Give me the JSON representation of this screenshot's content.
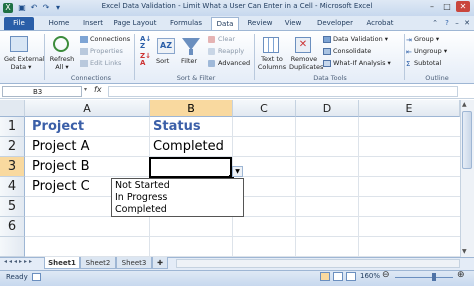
{
  "window": {
    "title": "Excel Data Validation - Limit What a User Can Enter in a Cell - Microsoft Excel"
  },
  "tabs": {
    "file": "File",
    "home": "Home",
    "insert": "Insert",
    "page_layout": "Page Layout",
    "formulas": "Formulas",
    "data": "Data",
    "review": "Review",
    "view": "View",
    "developer": "Developer",
    "acrobat": "Acrobat"
  },
  "ribbon": {
    "get_external_data": [
      "Get External",
      "Data ▾"
    ],
    "refresh_all": [
      "Refresh",
      "All ▾"
    ],
    "connections": "Connections",
    "properties": "Properties",
    "edit_links": "Edit Links",
    "sort": "Sort",
    "filter": "Filter",
    "clear": "Clear",
    "reapply": "Reapply",
    "advanced": "Advanced",
    "text_to_columns": [
      "Text to",
      "Columns"
    ],
    "remove_duplicates": [
      "Remove",
      "Duplicates"
    ],
    "data_validation": "Data Validation ▾",
    "consolidate": "Consolidate",
    "what_if": "What-If Analysis ▾",
    "group": "Group ▾",
    "ungroup": "Ungroup ▾",
    "subtotal": "Subtotal",
    "groups": {
      "connections": "Connections",
      "sort_filter": "Sort & Filter",
      "data_tools": "Data Tools",
      "outline": "Outline"
    }
  },
  "formula_bar": {
    "name_box": "B3",
    "fx": "fx",
    "content": ""
  },
  "columns": [
    "A",
    "B",
    "C",
    "D",
    "E"
  ],
  "rows": [
    "1",
    "2",
    "3",
    "4",
    "5",
    "6"
  ],
  "cells": {
    "A1": "Project",
    "B1": "Status",
    "A2": "Project A",
    "B2": "Completed",
    "A3": "Project B",
    "A4": "Project C"
  },
  "dropdown": {
    "options": [
      "Not Started",
      "In Progress",
      "Completed"
    ]
  },
  "sheets": [
    "Sheet1",
    "Sheet2",
    "Sheet3"
  ],
  "status": {
    "mode": "Ready",
    "zoom": "160%"
  },
  "colors": {
    "accent": "#2a5ea8",
    "header_text": "#3b5fa8",
    "selected_header": "#f9d99f"
  }
}
